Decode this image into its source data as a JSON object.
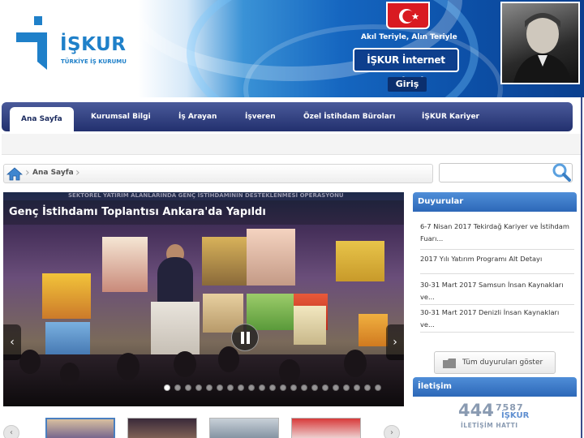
{
  "header": {
    "logo_text": "İŞKUR",
    "logo_subtitle": "TÜRKİYE İŞ KURUMU",
    "slogan": "Akıl Teriyle, Alın Teriyle",
    "internet_branch_label": "İŞKUR İnternet Şubesi",
    "login_label": "Giriş",
    "colors": {
      "brand_blue": "#1f80c9",
      "header_dark": "#0a3f8f",
      "flag_red": "#d91a21"
    }
  },
  "nav": {
    "items": [
      {
        "label": "Ana Sayfa",
        "active": true
      },
      {
        "label": "Kurumsal Bilgi",
        "active": false
      },
      {
        "label": "İş Arayan",
        "active": false
      },
      {
        "label": "İşveren",
        "active": false
      },
      {
        "label": "Özel İstihdam Büroları",
        "active": false
      },
      {
        "label": "İŞKUR Kariyer",
        "active": false
      }
    ]
  },
  "breadcrumb": {
    "home_icon": "home-icon",
    "current": "Ana Sayfa"
  },
  "search": {
    "icon": "search-icon"
  },
  "slider": {
    "title": "Genç İstihdamı Toplantısı Ankara'da Yapıldı",
    "banner_text": "SEKTÖREL YATIRIM ALANLARINDA GENÇ İSTİHDAMININ DESTEKLENMESİ OPERASYONU",
    "dot_count": 21,
    "active_dot": 0,
    "left_arrow": "‹",
    "right_arrow": "›"
  },
  "thumbnails": {
    "count": 4,
    "active_index": 0,
    "left_arrow": "‹",
    "right_arrow": "›"
  },
  "announcements": {
    "title": "Duyurular",
    "items": [
      "6-7 Nisan 2017 Tekirdağ Kariyer ve İstihdam Fuarı...",
      "2017 Yılı Yatırım Programı Alt Detayı",
      "30-31 Mart 2017 Samsun İnsan Kaynakları ve...",
      "30-31 Mart 2017 Denizli İnsan Kaynakları ve..."
    ],
    "all_label": "Tüm duyuruları göster"
  },
  "contact": {
    "title": "İletişim",
    "hotline_number_big": "444",
    "hotline_number_small": "7587",
    "hotline_brand": "İŞKUR",
    "hotline_label": "İLETİŞİM HATTI"
  }
}
